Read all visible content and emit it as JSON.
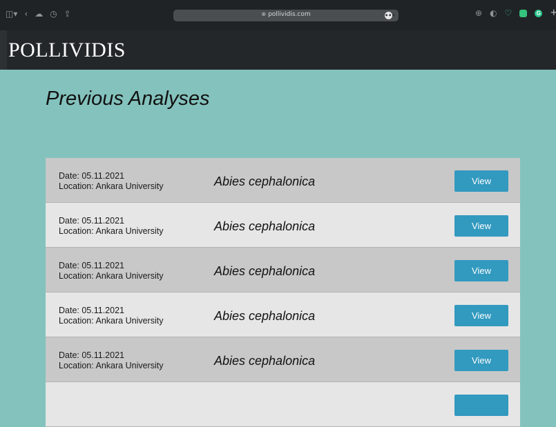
{
  "browser": {
    "url": "pollividis.com"
  },
  "site": {
    "logo": "POLLIVIDIS"
  },
  "page": {
    "title": "Previous Analyses"
  },
  "analyses": [
    {
      "date": "Date: 05.11.2021",
      "location": "Location: Ankara University",
      "species": "Abies cephalonica",
      "button": "View"
    },
    {
      "date": "Date: 05.11.2021",
      "location": "Location: Ankara University",
      "species": "Abies cephalonica",
      "button": "View"
    },
    {
      "date": "Date: 05.11.2021",
      "location": "Location: Ankara University",
      "species": "Abies cephalonica",
      "button": "View"
    },
    {
      "date": "Date: 05.11.2021",
      "location": "Location: Ankara University",
      "species": "Abies cephalonica",
      "button": "View"
    },
    {
      "date": "Date: 05.11.2021",
      "location": "Location: Ankara University",
      "species": "Abies cephalonica",
      "button": "View"
    },
    {
      "date": "",
      "location": "",
      "species": "",
      "button": ""
    }
  ]
}
